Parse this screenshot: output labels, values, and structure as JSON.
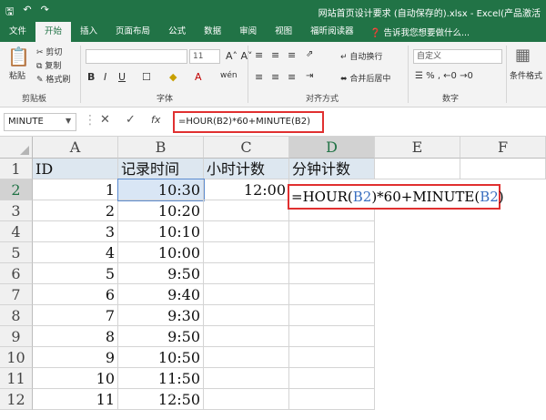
{
  "title": "网站首页设计要求 (自动保存的).xlsx - Excel(产品激活",
  "tabs": [
    "文件",
    "开始",
    "插入",
    "页面布局",
    "公式",
    "数据",
    "审阅",
    "视图",
    "福昕阅读器"
  ],
  "tell_me": "告诉我您想要做什么...",
  "ribbon": {
    "paste": "粘贴",
    "cut": "剪切",
    "copy": "复制",
    "format_painter": "格式刷",
    "clipboard_label": "剪贴板",
    "font_label": "字体",
    "font_size": "11",
    "wrap_text": "自动换行",
    "merge_center": "合并后居中",
    "alignment_label": "对齐方式",
    "number_format": "自定义",
    "number_label": "数字",
    "conditional_format": "条件格式"
  },
  "name_box": "MINUTE",
  "fx": "fx",
  "formula_bar": "=HOUR(B2)*60+MINUTE(B2)",
  "columns": [
    "A",
    "B",
    "C",
    "D",
    "E",
    "F"
  ],
  "rows": [
    "1",
    "2",
    "3",
    "4",
    "5",
    "6",
    "7",
    "8",
    "9",
    "10",
    "11",
    "12"
  ],
  "headers": [
    "ID",
    "记录时间",
    "小时计数",
    "分钟计数"
  ],
  "ids": [
    "1",
    "2",
    "3",
    "4",
    "5",
    "6",
    "7",
    "8",
    "9",
    "10",
    "11"
  ],
  "times": [
    "10:30",
    "10:20",
    "10:10",
    "10:00",
    "9:50",
    "9:40",
    "9:30",
    "9:50",
    "10:50",
    "11:50",
    "12:50"
  ],
  "c2": "12:00",
  "edit": {
    "p1": "=HOUR(",
    "r1": "B2",
    "p2": ")*60+MINUTE(",
    "r2": "B2",
    "p3": ")"
  },
  "colors": {
    "accent": "#217346",
    "highlight": "#e03030",
    "ref": "#3a6fc0"
  }
}
